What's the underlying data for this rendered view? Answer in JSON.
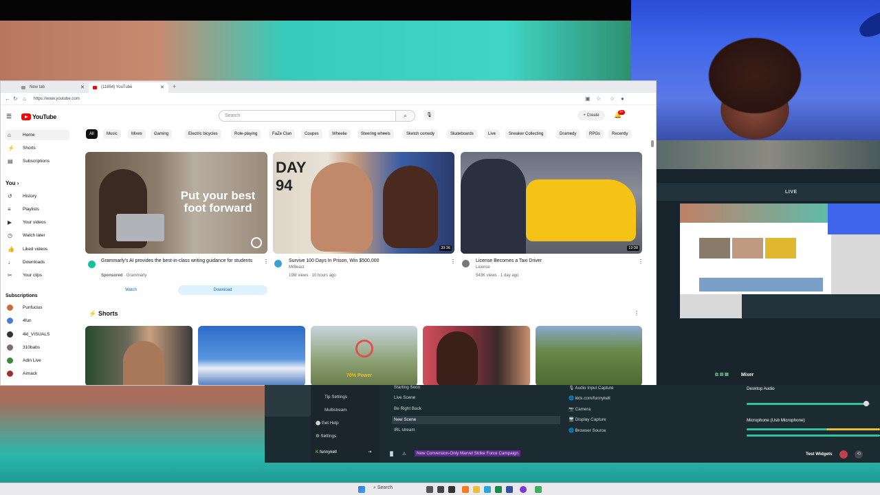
{
  "browser": {
    "tabs": [
      {
        "label": "New tab"
      },
      {
        "label": "(11854) YouTube"
      }
    ],
    "url": "https://www.youtube.com"
  },
  "youtube": {
    "logo": "YouTube",
    "search_placeholder": "Search",
    "create_label": "Create",
    "notif_badge": "9+",
    "sidebar": {
      "main": [
        {
          "label": "Home",
          "icon": "home-icon"
        },
        {
          "label": "Shorts",
          "icon": "shorts-icon"
        },
        {
          "label": "Subscriptions",
          "icon": "subscriptions-icon"
        }
      ],
      "you_header": "You",
      "you": [
        {
          "label": "History",
          "icon": "history-icon"
        },
        {
          "label": "Playlists",
          "icon": "playlists-icon"
        },
        {
          "label": "Your videos",
          "icon": "your-videos-icon"
        },
        {
          "label": "Watch later",
          "icon": "watch-later-icon"
        },
        {
          "label": "Liked videos",
          "icon": "liked-videos-icon"
        },
        {
          "label": "Downloads",
          "icon": "downloads-icon"
        },
        {
          "label": "Your clips",
          "icon": "clips-icon"
        }
      ],
      "subscriptions_header": "Subscriptions",
      "subscriptions": [
        {
          "label": "Punfucius",
          "color": "#c86c3a"
        },
        {
          "label": "4fun",
          "color": "#4a7bd6"
        },
        {
          "label": "4kl_VISUALS",
          "color": "#333333"
        },
        {
          "label": "310babs",
          "color": "#7a6f6a"
        },
        {
          "label": "Adin Live",
          "color": "#3c8a3c"
        },
        {
          "label": "Aimack",
          "color": "#a03030"
        }
      ]
    },
    "chips": [
      "All",
      "Music",
      "Mixes",
      "Gaming",
      "Electric bicycles",
      "Role-playing",
      "FaZe Clan",
      "Coupes",
      "Wheelie",
      "Steering wheels",
      "Sketch comedy",
      "Skateboards",
      "Live",
      "Sneaker Collecting",
      "Dramedy",
      "RPGs",
      "Recently"
    ],
    "videos": [
      {
        "title": "Grammarly's AI provides the best-in-class writing guidance for students",
        "meta_sponsored": "Sponsored",
        "channel": "Grammarly",
        "overlay": "Put your best foot forward",
        "watch": "Watch",
        "download": "Download"
      },
      {
        "title": "Survive 100 Days In Prison, Win $500,000",
        "channel": "MrBeast",
        "meta": "19M views · 10 hours ago",
        "duration": "39:36",
        "overlay": "DAY 94"
      },
      {
        "title": "License Becomes a Taxi Driver",
        "channel": "License",
        "meta": "543K views · 1 day ago",
        "duration": "13:38"
      }
    ],
    "shorts_title": "Shorts",
    "shorts_overlay": "70% Power"
  },
  "obs": {
    "live_label": "LIVE",
    "mixer_title": "Mixer",
    "left_menu": [
      "Tip Settings",
      "Multistream",
      "Get Help",
      "Settings"
    ],
    "account": "funnykell",
    "scenes": [
      "Starting Soon",
      "Live Scene",
      "Be Right Back",
      "New Scene",
      "IRL stream"
    ],
    "sources": [
      "Audio Input Capture",
      "kick.com/funnykell",
      "Camera",
      "Display Capture",
      "Browser Source"
    ],
    "audio": [
      {
        "label": "Desktop Audio",
        "level": 0.95
      },
      {
        "label": "Microphone (Usb Microphone)",
        "level": 1.0
      }
    ],
    "ticker": "New Conversion-Only Marvel Strike Force Campaign",
    "test_widgets": "Test Widgets"
  },
  "taskbar": {
    "search": "Search"
  }
}
